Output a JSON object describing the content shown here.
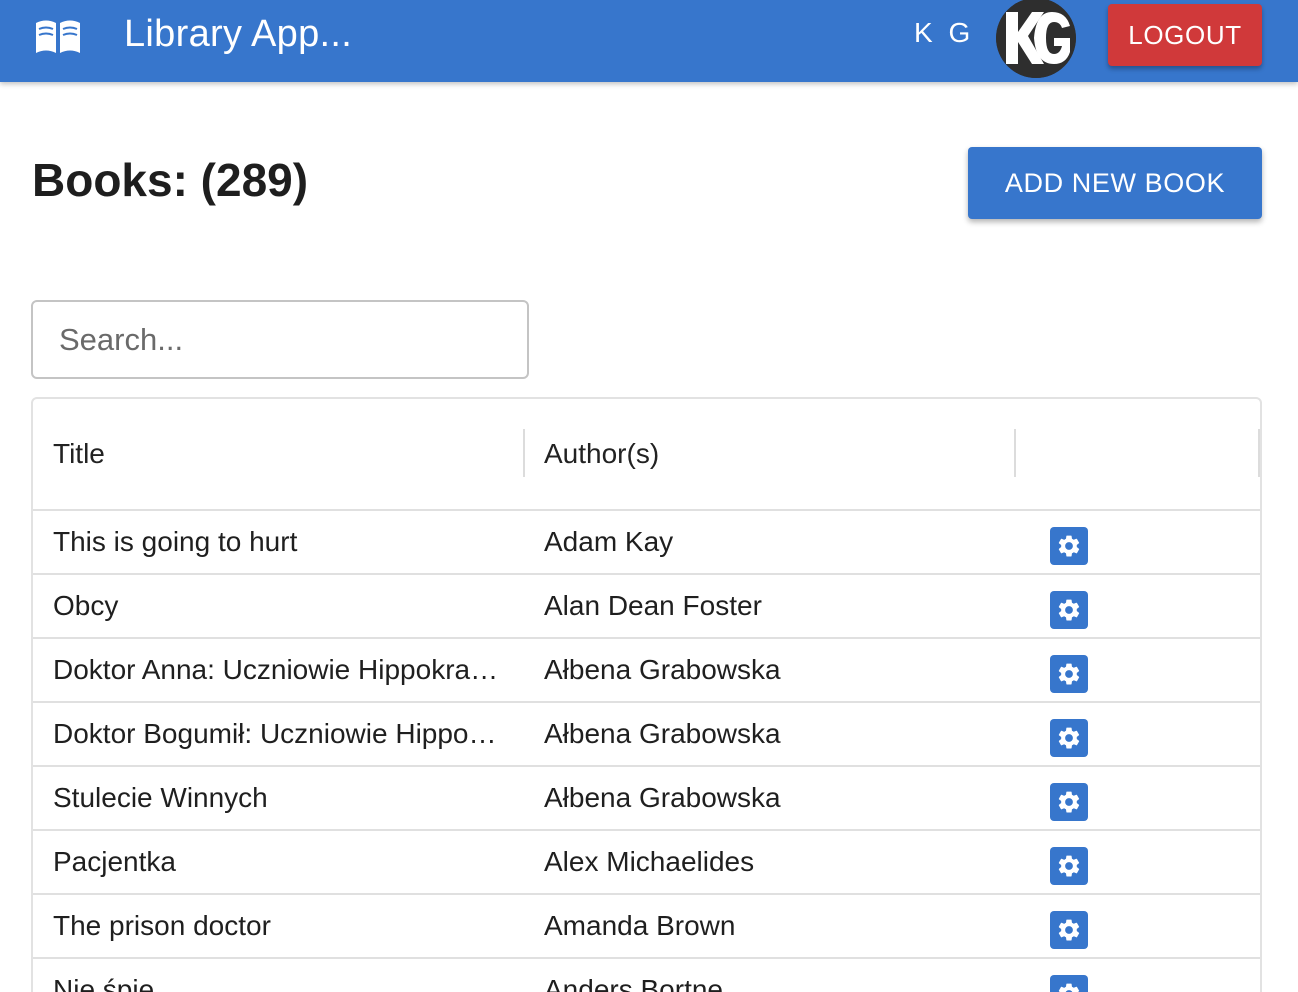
{
  "app": {
    "title": "Library App...",
    "user_initials": "K G",
    "logout_label": "LOGOUT",
    "avatar_alt": "KG"
  },
  "page": {
    "heading": "Books: (289)",
    "add_button_label": "ADD NEW BOOK"
  },
  "search": {
    "placeholder": "Search...",
    "value": ""
  },
  "table": {
    "columns": [
      "Title",
      "Author(s)",
      ""
    ],
    "rows": [
      {
        "title": "This is going to hurt",
        "author": "Adam Kay"
      },
      {
        "title": "Obcy",
        "author": "Alan Dean Foster"
      },
      {
        "title": "Doktor Anna: Uczniowie Hippokratesa",
        "author": "Ałbena Grabowska"
      },
      {
        "title": "Doktor Bogumił: Uczniowie Hippokratesa",
        "author": "Ałbena Grabowska"
      },
      {
        "title": "Stulecie Winnych",
        "author": "Ałbena Grabowska"
      },
      {
        "title": "Pacjentka",
        "author": "Alex Michaelides"
      },
      {
        "title": "The prison doctor",
        "author": "Amanda Brown"
      },
      {
        "title": "Nie śpię",
        "author": "Anders Bortne"
      }
    ]
  },
  "colors": {
    "primary": "#3776cc",
    "danger": "#d0393a",
    "text": "#1f1f1f"
  },
  "icons": {
    "logo": "open-book-icon",
    "row_action": "gear-icon"
  }
}
